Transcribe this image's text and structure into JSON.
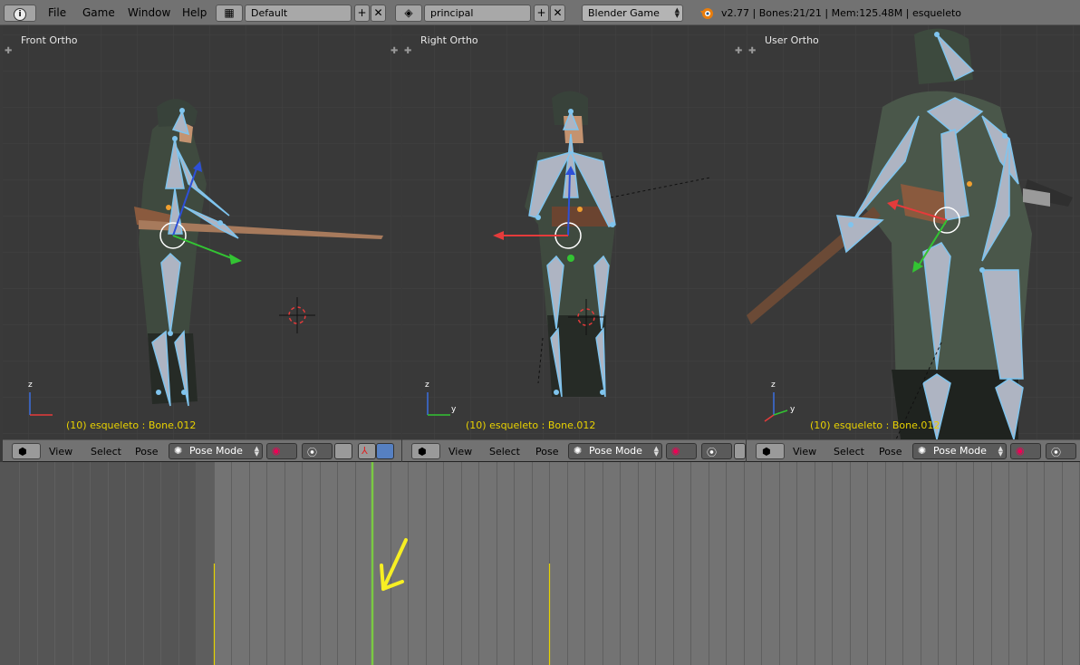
{
  "topbar": {
    "menus": [
      "File",
      "Game",
      "Window",
      "Help"
    ],
    "screen_layout": "Default",
    "scene": "principal",
    "engine": "Blender Game",
    "version": "v2.77",
    "bones": "Bones:21/21",
    "mem": "Mem:125.48M",
    "object": "esqueleto"
  },
  "viewports": [
    {
      "title": "Front Ortho",
      "status": "(10) esqueleto : Bone.012"
    },
    {
      "title": "Right Ortho",
      "status": "(10) esqueleto : Bone.012"
    },
    {
      "title": "User Ortho",
      "status": "(10) esqueleto : Bone.012"
    }
  ],
  "header": {
    "view": "View",
    "select": "Select",
    "pose": "Pose",
    "mode": "Pose Mode"
  },
  "axes": {
    "x": "x",
    "y": "y",
    "z": "z"
  },
  "colors": {
    "ui_bg": "#727272",
    "viewport_bg": "#393939",
    "status_text": "#e9d200",
    "bone": "#7fc4ee",
    "playhead": "#7ac943",
    "annotation_arrow": "#f7ef23",
    "keyframe": "#e6d300"
  },
  "icons": [
    "info-icon",
    "screen-layout-icon",
    "scene-icon",
    "blender-logo-icon",
    "view3d-editor-icon",
    "pose-mode-icon",
    "shading-icon",
    "pivot-icon",
    "manipulator-icon",
    "add-icon",
    "close-icon"
  ]
}
